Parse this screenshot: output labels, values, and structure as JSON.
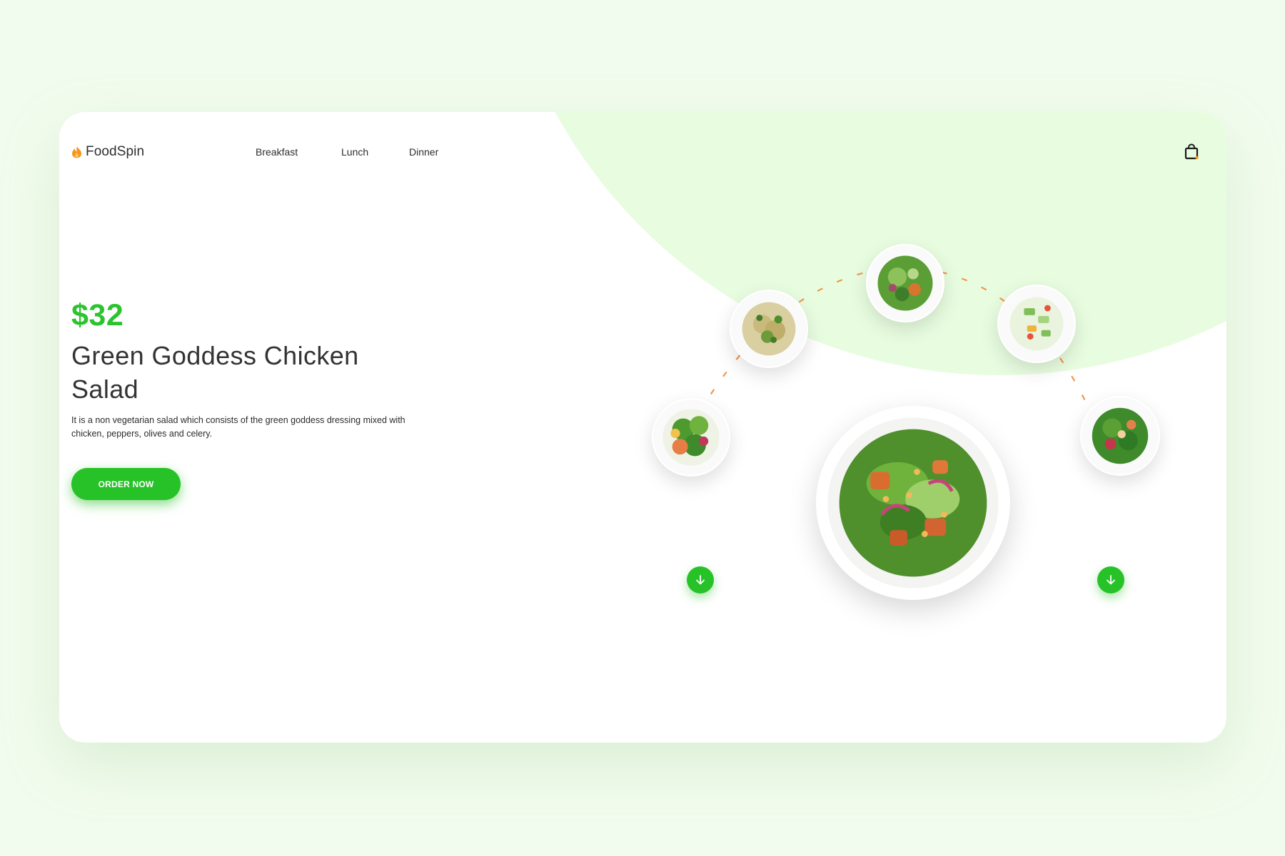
{
  "brand": {
    "name": "FoodSpin",
    "logo_icon": "flame-icon"
  },
  "nav": {
    "items": [
      "Breakfast",
      "Lunch",
      "Dinner"
    ],
    "cart_icon": "shopping-bag-icon"
  },
  "hero": {
    "price": "$32",
    "title": "Green Goddess Chicken Salad",
    "description": "It is a non vegetarian salad which consists of the green goddess dressing mixed with chicken, peppers, olives and celery.",
    "cta_label": "ORDER NOW"
  },
  "carousel": {
    "prev_icon": "arrow-down-icon",
    "next_icon": "arrow-down-icon"
  },
  "colors": {
    "accent": "#27c128",
    "background": "#f2fcee",
    "circle": "#e8fde0",
    "logo_orange": "#f7941d",
    "arc_dash": "#f2954b"
  }
}
